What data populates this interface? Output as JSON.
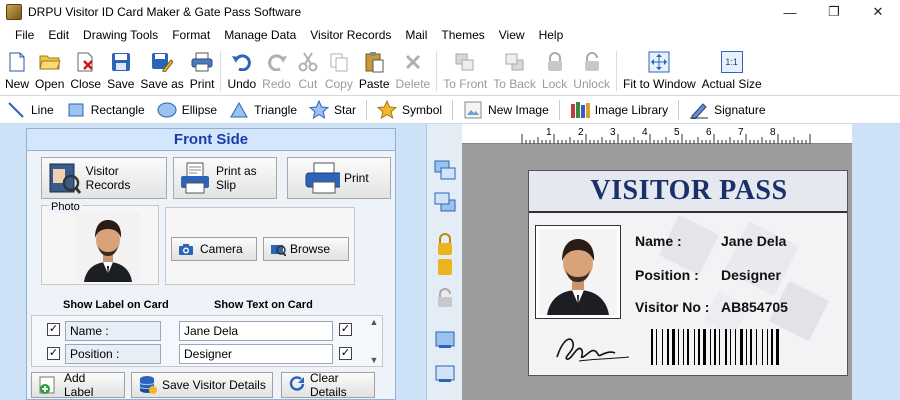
{
  "window": {
    "title": "DRPU Visitor ID Card Maker & Gate Pass Software"
  },
  "menu": [
    "File",
    "Edit",
    "Drawing Tools",
    "Format",
    "Manage Data",
    "Visitor Records",
    "Mail",
    "Themes",
    "View",
    "Help"
  ],
  "toolbar": {
    "new": "New",
    "open": "Open",
    "close": "Close",
    "save": "Save",
    "save_as": "Save as",
    "print": "Print",
    "undo": "Undo",
    "redo": "Redo",
    "cut": "Cut",
    "copy": "Copy",
    "paste": "Paste",
    "delete": "Delete",
    "to_front": "To Front",
    "to_back": "To Back",
    "lock": "Lock",
    "unlock": "Unlock",
    "fit_to_window": "Fit to Window",
    "actual_size": "Actual Size",
    "actual_size_icon": "1:1"
  },
  "drawing": {
    "line": "Line",
    "rectangle": "Rectangle",
    "ellipse": "Ellipse",
    "triangle": "Triangle",
    "star": "Star",
    "symbol": "Symbol",
    "new_image": "New Image",
    "image_library": "Image Library",
    "signature": "Signature"
  },
  "panel": {
    "title": "Front Side",
    "visitor_records": "Visitor Records",
    "print_as_slip": "Print as Slip",
    "print": "Print",
    "photo_label": "Photo",
    "camera": "Camera",
    "browse": "Browse",
    "show_label_header": "Show Label on Card",
    "show_text_header": "Show Text on Card",
    "rows": [
      {
        "label": "Name :",
        "text": "Jane Dela"
      },
      {
        "label": "Position :",
        "text": "Designer"
      }
    ],
    "add_label": "Add Label",
    "save_visitor_details": "Save Visitor Details",
    "clear_details": "Clear Details"
  },
  "ruler": [
    "1",
    "2",
    "3",
    "4",
    "5",
    "6",
    "7",
    "8"
  ],
  "card": {
    "title": "VISITOR PASS",
    "name_label": "Name :",
    "name_value": "Jane Dela",
    "position_label": "Position :",
    "position_value": "Designer",
    "visitor_no_label": "Visitor No :",
    "visitor_no_value": "AB854705"
  },
  "colors": {
    "accent": "#1a3ea8",
    "card_title": "#1c2f6b",
    "panel_bg": "#cde1f7"
  }
}
